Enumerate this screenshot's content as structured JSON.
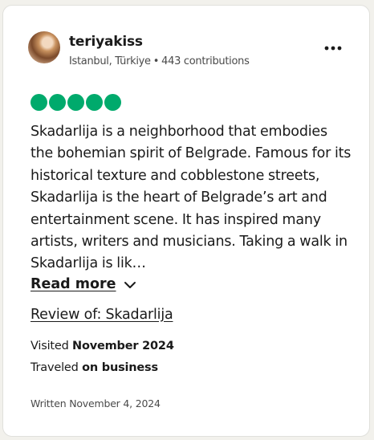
{
  "review": {
    "author": {
      "username": "teriyakiss",
      "location": "Istanbul, Türkiye",
      "separator": "•",
      "contributions": "443 contributions"
    },
    "rating": {
      "value": 5,
      "max": 5,
      "color": "#00aa6c"
    },
    "body": "Skadarlija is a neighborhood that embodies the bohemian spirit of Belgrade. Famous for its historical texture and cobblestone streets, Skadarlija is the heart of Belgrade’s art and entertainment scene. It has inspired many artists, writers and musicians. Taking a walk in Skadarlija is lik…",
    "read_more_label": "Read more",
    "review_of_label": "Review of: Skadarlija",
    "visited_prefix": "Visited",
    "visited_value": "November 2024",
    "traveled_prefix": "Traveled",
    "traveled_value": "on business",
    "written": "Written November 4, 2024"
  },
  "icons": {
    "more": "more-horizontal-icon",
    "chevron": "chevron-down-icon"
  }
}
